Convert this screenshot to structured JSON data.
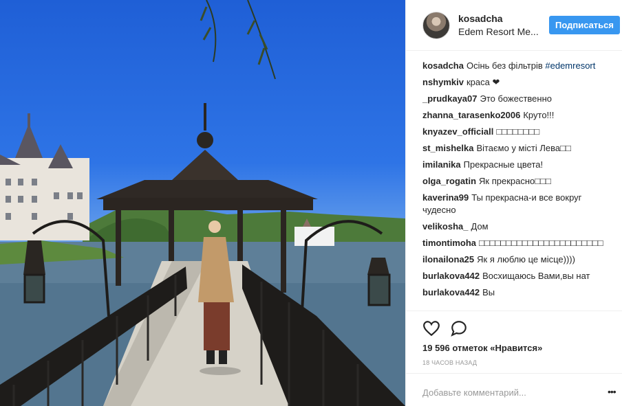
{
  "post": {
    "username": "kosadcha",
    "location": "Edem Resort Me...",
    "follow_label": "Подписаться",
    "photo_alt": "photo"
  },
  "comments": [
    {
      "user": "kosadcha",
      "text": "Осінь без фільтрів ",
      "tag": "#edemresort"
    },
    {
      "user": "nshymkiv",
      "text": "краса ❤"
    },
    {
      "user": "_prudkaya07",
      "text": "Это божественно"
    },
    {
      "user": "zhanna_tarasenko2006",
      "text": "Круто!!!"
    },
    {
      "user": "knyazev_officiall",
      "text": "□□□□□□□□"
    },
    {
      "user": "st_mishelka",
      "text": "Вітаємо у місті Лева□□"
    },
    {
      "user": "imilanika",
      "text": "Прекрасные цвета!"
    },
    {
      "user": "olga_rogatin",
      "text": "Як прекрасно□□□"
    },
    {
      "user": "kaverina99",
      "text": "Ты прекрасна-и все вокруг чудесно"
    },
    {
      "user": "velikosha_",
      "text": "Дом"
    },
    {
      "user": "timontimoha",
      "text": "□□□□□□□□□□□□□□□□□□□□□□□"
    },
    {
      "user": "ilonailona25",
      "text": "Як я люблю це місце))))"
    },
    {
      "user": "burlakova442",
      "text": "Восхищаюсь Вами,вы нат"
    },
    {
      "user": "burlakova442",
      "text": "Вы"
    }
  ],
  "stats": {
    "likes": "19 596 отметок «Нравится»",
    "time": "18 часов назад"
  },
  "add_comment": {
    "placeholder": "Добавьте комментарий...",
    "more": "•••"
  },
  "icons": {
    "like": "heart-icon",
    "comment": "comment-bubble-icon",
    "more": "more-dots-icon"
  }
}
